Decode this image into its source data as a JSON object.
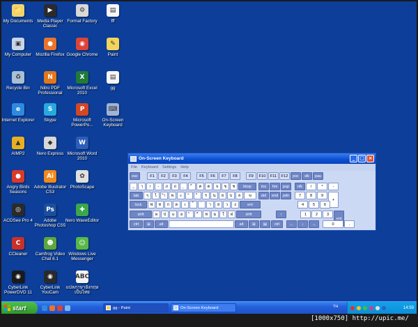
{
  "desktop": {
    "icons": [
      {
        "label": "My Documents",
        "icon": "folder-documents-icon",
        "glyph": "📁",
        "color": "#f3d46b"
      },
      {
        "label": "Media Player Classic",
        "icon": "media-player-icon",
        "glyph": "▶",
        "color": "#2b2b2b"
      },
      {
        "label": "Format Factory",
        "icon": "format-factory-icon",
        "glyph": "⚙",
        "color": "#d8d8d8"
      },
      {
        "label": "fff",
        "icon": "file-icon",
        "glyph": "▤",
        "color": "#f6f6f6"
      },
      {
        "label": "My Computer",
        "icon": "my-computer-icon",
        "glyph": "▣",
        "color": "#c9d4e8"
      },
      {
        "label": "Mozilla Firefox",
        "icon": "firefox-icon",
        "glyph": "●",
        "color": "#e8742c"
      },
      {
        "label": "Google Chrome",
        "icon": "chrome-icon",
        "glyph": "◉",
        "color": "#db4437"
      },
      {
        "label": "Paint",
        "icon": "paint-icon",
        "glyph": "✎",
        "color": "#f2d45c"
      },
      {
        "label": "Recycle Bin",
        "icon": "recycle-bin-icon",
        "glyph": "♻",
        "color": "#a9bfd6"
      },
      {
        "label": "Nitro PDF Professional",
        "icon": "nitro-pdf-icon",
        "glyph": "N",
        "color": "#e3771c"
      },
      {
        "label": "Microsoft Excel 2010",
        "icon": "excel-icon",
        "glyph": "X",
        "color": "#1f7a3c"
      },
      {
        "label": "gg",
        "icon": "image-file-icon",
        "glyph": "▤",
        "color": "#f6f6f6"
      },
      {
        "label": "Internet Explorer",
        "icon": "internet-explorer-icon",
        "glyph": "e",
        "color": "#2d8ae0"
      },
      {
        "label": "Skype",
        "icon": "skype-icon",
        "glyph": "S",
        "color": "#27a8e0"
      },
      {
        "label": "Microsoft PowerPo...",
        "icon": "powerpoint-icon",
        "glyph": "P",
        "color": "#d24726"
      },
      {
        "label": "On-Screen Keyboard",
        "icon": "keyboard-icon",
        "glyph": "⌨",
        "color": "#9fb3d6"
      },
      {
        "label": "AIMP2",
        "icon": "aimp-icon",
        "glyph": "▲",
        "color": "#e8b020"
      },
      {
        "label": "Nero Express",
        "icon": "nero-express-icon",
        "glyph": "◆",
        "color": "#d8d8d8"
      },
      {
        "label": "Microsoft Word 2010",
        "icon": "word-icon",
        "glyph": "W",
        "color": "#2b5eb8"
      },
      {
        "label": "Angry Birds Seasons",
        "icon": "angry-birds-icon",
        "glyph": "●",
        "color": "#d93a2a"
      },
      {
        "label": "Adobe Illustrator CS3",
        "icon": "illustrator-icon",
        "glyph": "Ai",
        "color": "#f08a1c"
      },
      {
        "label": "PhotoScape",
        "icon": "photoscape-icon",
        "glyph": "✿",
        "color": "#e0e0e0"
      },
      {
        "label": "ACDSee Pro 4",
        "icon": "acdsee-icon",
        "glyph": "◎",
        "color": "#2a2a2a"
      },
      {
        "label": "Adobe Photoshop CS5",
        "icon": "photoshop-icon",
        "glyph": "Ps",
        "color": "#1b4f9c"
      },
      {
        "label": "Nero WaveEditor",
        "icon": "nero-wave-editor-icon",
        "glyph": "✚",
        "color": "#3aa84a"
      },
      {
        "label": "CCleaner",
        "icon": "ccleaner-icon",
        "glyph": "C",
        "color": "#c8302a"
      },
      {
        "label": "Camfrog Video Chat 6.1",
        "icon": "camfrog-icon",
        "glyph": "☻",
        "color": "#5ca83a"
      },
      {
        "label": "Windows Live Messenger",
        "icon": "messenger-icon",
        "glyph": "☺",
        "color": "#58b848"
      },
      {
        "label": "CyberLink PowerDVD 11",
        "icon": "powerdvd-icon",
        "glyph": "◉",
        "color": "#1a1a1a"
      },
      {
        "label": "CyberLink YouCam",
        "icon": "youcam-icon",
        "glyph": "◉",
        "color": "#2a2a2a"
      },
      {
        "label": "แปลภาษาอังกฤษเป็นไทย",
        "icon": "abc-translator-icon",
        "glyph": "ABC",
        "color": "#f4f4f4"
      }
    ]
  },
  "osk": {
    "title": "On-Screen Keyboard",
    "menu": [
      "File",
      "Keyboard",
      "Settings",
      "Help"
    ],
    "rows": [
      {
        "keys": [
          "esc",
          "",
          "F1",
          "F2",
          "F3",
          "F4",
          "",
          "F5",
          "F6",
          "F7",
          "F8",
          "",
          "F9",
          "F10",
          "F11",
          "F12",
          "psc",
          "slk",
          "pau"
        ]
      },
      {
        "keys": [
          "_",
          "ๅ",
          "/",
          "-",
          "ภ",
          "ถ",
          "ุ",
          "ึ",
          "ค",
          "ต",
          "จ",
          "ข",
          "ช",
          "bksp",
          "ins",
          "hm",
          "pup",
          "nlk",
          "/",
          "*",
          "-"
        ]
      },
      {
        "keys": [
          "tab",
          "ๆ",
          "ไ",
          "ำ",
          "พ",
          "ะ",
          "ั",
          "ี",
          "ร",
          "น",
          "ย",
          "บ",
          "ล",
          "ฃ",
          "del",
          "end",
          "pdn",
          "7",
          "8",
          "9",
          "+"
        ]
      },
      {
        "keys": [
          "lock",
          "ฟ",
          "ห",
          "ก",
          "ด",
          "เ",
          "้",
          "่",
          "า",
          "ส",
          "ว",
          "ง",
          "ent",
          "4",
          "5",
          "6"
        ]
      },
      {
        "keys": [
          "shft",
          "ผ",
          "ป",
          "แ",
          "อ",
          "ิ",
          "ื",
          "ท",
          "ม",
          "ใ",
          "ฝ",
          "shft",
          "↑",
          "1",
          "2",
          "3",
          "ent"
        ]
      },
      {
        "keys": [
          "ctrl",
          "⊞",
          "alt",
          "",
          "alt",
          "⊞",
          "▤",
          "ctrl",
          "←",
          "↓",
          "→",
          "0",
          "."
        ]
      }
    ]
  },
  "taskbar": {
    "start_label": "start",
    "tasks": [
      {
        "label": "gg - Paint"
      },
      {
        "label": "On-Screen Keyboard"
      }
    ],
    "language": "TH",
    "clock": "14:59"
  },
  "watermark": "[1000x750] http://upic.me/",
  "colors": {
    "desktop": "#0c3e9a",
    "taskbar": "#245edb",
    "start": "#3a9c36",
    "key_dark": "#6f86c6"
  }
}
